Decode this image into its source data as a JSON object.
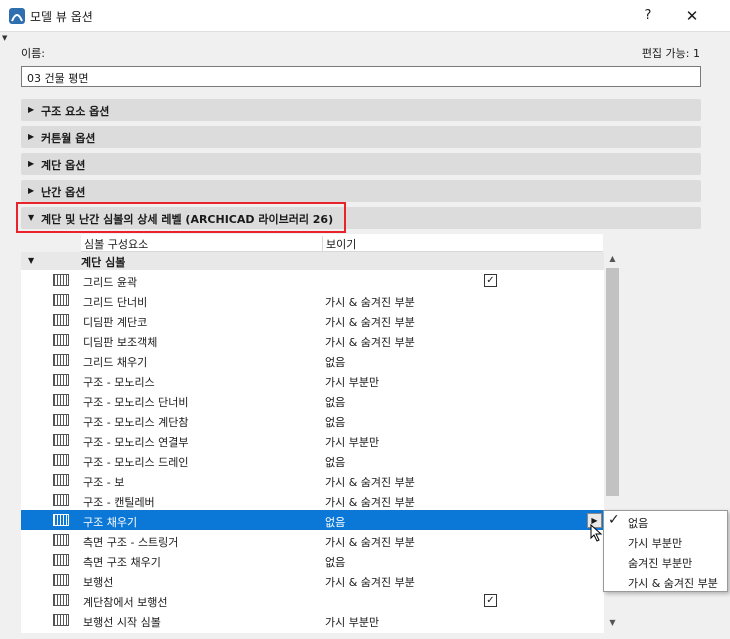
{
  "window": {
    "title": "모델 뷰 옵션",
    "help": "?",
    "close": "✕",
    "corner": "▼"
  },
  "name": {
    "label": "이름:",
    "value": "03 건물 평면",
    "editable": "편집 가능: 1"
  },
  "panels": [
    {
      "label": "구조 요소 옵션",
      "arrow": "▶"
    },
    {
      "label": "커튼월 옵션",
      "arrow": "▶"
    },
    {
      "label": "계단 옵션",
      "arrow": "▶"
    },
    {
      "label": "난간 옵션",
      "arrow": "▶"
    },
    {
      "label": "계단 및 난간 심볼의 상세 레벨 (ARCHICAD 라이브러리 26)",
      "arrow": "▼"
    }
  ],
  "table": {
    "col1": "심볼 구성요소",
    "col2": "보이기",
    "group": "계단 심볼",
    "group_arrow": "▼",
    "rows": [
      {
        "name": "그리드 윤곽",
        "value": "",
        "check": "✓"
      },
      {
        "name": "그리드 단너비",
        "value": "가시 & 숨겨진 부분"
      },
      {
        "name": "디딤판 계단코",
        "value": "가시 & 숨겨진 부분"
      },
      {
        "name": "디딤판 보조객체",
        "value": "가시 & 숨겨진 부분"
      },
      {
        "name": "그리드 채우기",
        "value": "없음"
      },
      {
        "name": "구조 - 모노리스",
        "value": "가시 부분만"
      },
      {
        "name": "구조 - 모노리스 단너비",
        "value": "없음"
      },
      {
        "name": "구조 - 모노리스 계단참",
        "value": "없음"
      },
      {
        "name": "구조 - 모노리스 연결부",
        "value": "가시 부분만"
      },
      {
        "name": "구조 - 모노리스 드레인",
        "value": "없음"
      },
      {
        "name": "구조 - 보",
        "value": "가시 & 숨겨진 부분"
      },
      {
        "name": "구조 - 캔틸레버",
        "value": "가시 & 숨겨진 부분"
      },
      {
        "name": "구조 채우기",
        "value": "없음",
        "dd": "▶"
      },
      {
        "name": "측면 구조 - 스트링거",
        "value": "가시 & 숨겨진 부분"
      },
      {
        "name": "측면 구조 채우기",
        "value": "없음"
      },
      {
        "name": "보행선",
        "value": "가시 & 숨겨진 부분"
      },
      {
        "name": "계단참에서 보행선",
        "value": "",
        "check": "✓"
      },
      {
        "name": "보행선 시작 심볼",
        "value": "가시 부분만"
      }
    ]
  },
  "scroll": {
    "up": "▲",
    "down": "▼"
  },
  "popup": {
    "check": "✓",
    "options": [
      "없음",
      "가시 부분만",
      "숨겨진 부분만",
      "가시 & 숨겨진 부분"
    ]
  },
  "colors": {
    "selection": "#0b78d7",
    "highlight": "#e8232a"
  }
}
